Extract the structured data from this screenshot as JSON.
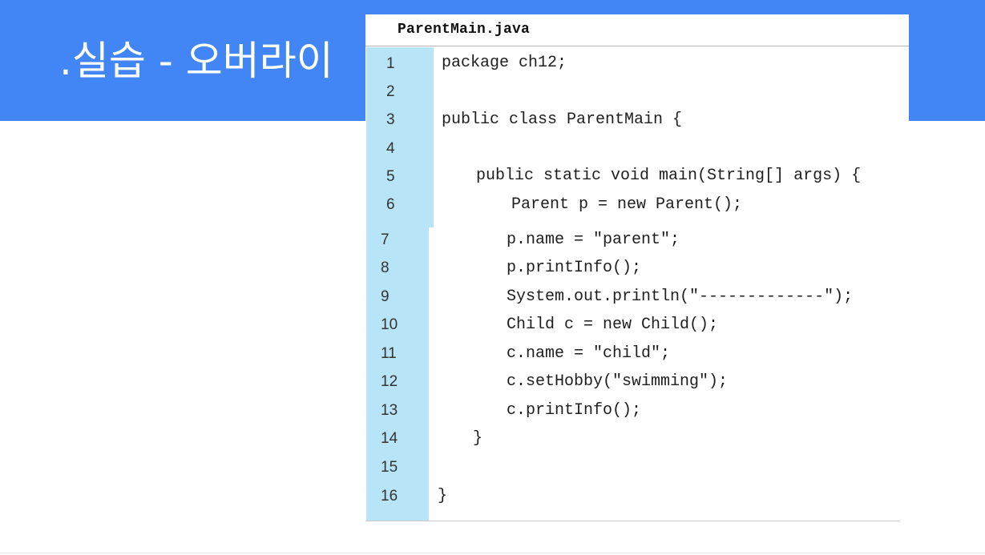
{
  "slide": {
    "title": ".실습 - 오버라이"
  },
  "code": {
    "filename": "ParentMain.java",
    "lines": [
      {
        "num": "1",
        "text": "package ch12;"
      },
      {
        "num": "2",
        "text": ""
      },
      {
        "num": "3",
        "text": "public class ParentMain {"
      },
      {
        "num": "4",
        "text": ""
      },
      {
        "num": "5",
        "text": "public static void main(String[] args) {"
      },
      {
        "num": "6",
        "text": "Parent p = new Parent();"
      },
      {
        "num": "7",
        "text": "p.name = \"parent\";"
      },
      {
        "num": "8",
        "text": "p.printInfo();"
      },
      {
        "num": "9",
        "text": "System.out.println(\"-------------\");"
      },
      {
        "num": "10",
        "text": "Child c = new Child();"
      },
      {
        "num": "11",
        "text": "c.name = \"child\";"
      },
      {
        "num": "12",
        "text": "c.setHobby(\"swimming\");"
      },
      {
        "num": "13",
        "text": "c.printInfo();"
      },
      {
        "num": "14",
        "text": "}"
      },
      {
        "num": "15",
        "text": ""
      },
      {
        "num": "16",
        "text": "}"
      }
    ]
  },
  "colors": {
    "header": "#4285f4",
    "gutter": "#b8e4f8"
  }
}
